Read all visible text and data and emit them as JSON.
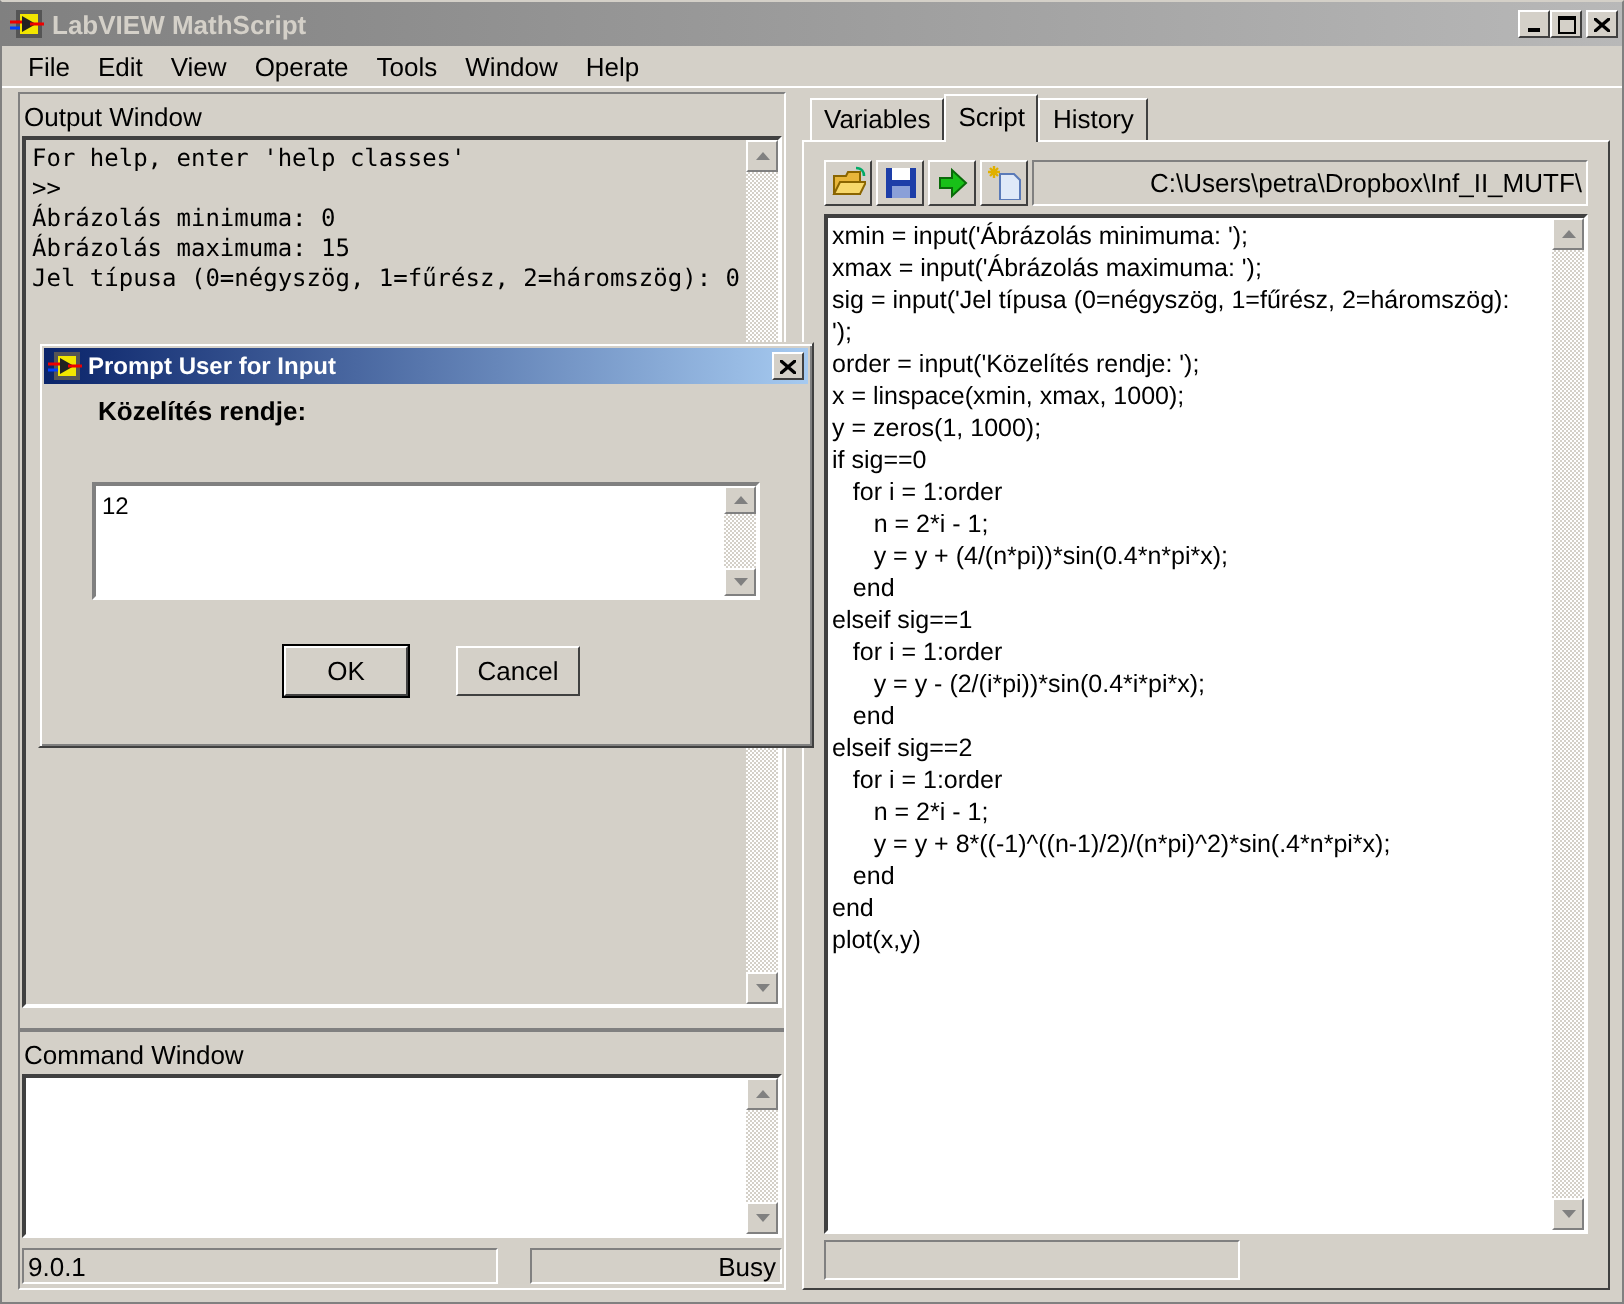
{
  "window": {
    "title": "LabVIEW MathScript"
  },
  "menu": [
    "File",
    "Edit",
    "View",
    "Operate",
    "Tools",
    "Window",
    "Help"
  ],
  "output_window": {
    "label": "Output Window",
    "lines": [
      "For help, enter 'help classes'",
      ">>",
      "Ábrázolás minimuma: 0",
      "Ábrázolás maximuma: 15",
      "Jel típusa (0=négyszög, 1=fűrész, 2=háromszög): 0"
    ]
  },
  "command_window": {
    "label": "Command Window"
  },
  "status_bar": {
    "version": "9.0.1",
    "state": "Busy"
  },
  "tabs": [
    {
      "label": "Variables",
      "selected": false
    },
    {
      "label": "Script",
      "selected": true
    },
    {
      "label": "History",
      "selected": false
    }
  ],
  "script": {
    "path": "C:\\Users\\petra\\Dropbox\\Inf_II_MUTF\\",
    "lines": [
      "xmin = input('Ábrázolás minimuma: ');",
      "xmax = input('Ábrázolás maximuma: ');",
      "sig = input('Jel típusa (0=négyszög, 1=fűrész, 2=háromszög):",
      "');",
      "order = input('Közelítés rendje: ');",
      "x = linspace(xmin, xmax, 1000);",
      "y = zeros(1, 1000);",
      "if sig==0",
      "   for i = 1:order",
      "      n = 2*i - 1;",
      "      y = y + (4/(n*pi))*sin(0.4*n*pi*x);",
      "   end",
      "elseif sig==1",
      "   for i = 1:order",
      "      y = y - (2/(i*pi))*sin(0.4*i*pi*x);",
      "   end",
      "elseif sig==2",
      "   for i = 1:order",
      "      n = 2*i - 1;",
      "      y = y + 8*((-1)^((n-1)/2)/(n*pi)^2)*sin(.4*n*pi*x);",
      "   end",
      "end",
      "plot(x,y)"
    ]
  },
  "dialog": {
    "title": "Prompt User for Input",
    "prompt": "Közelítés rendje:",
    "value": "12",
    "buttons": [
      {
        "label": "OK",
        "default": true
      },
      {
        "label": "Cancel",
        "default": false
      }
    ]
  }
}
